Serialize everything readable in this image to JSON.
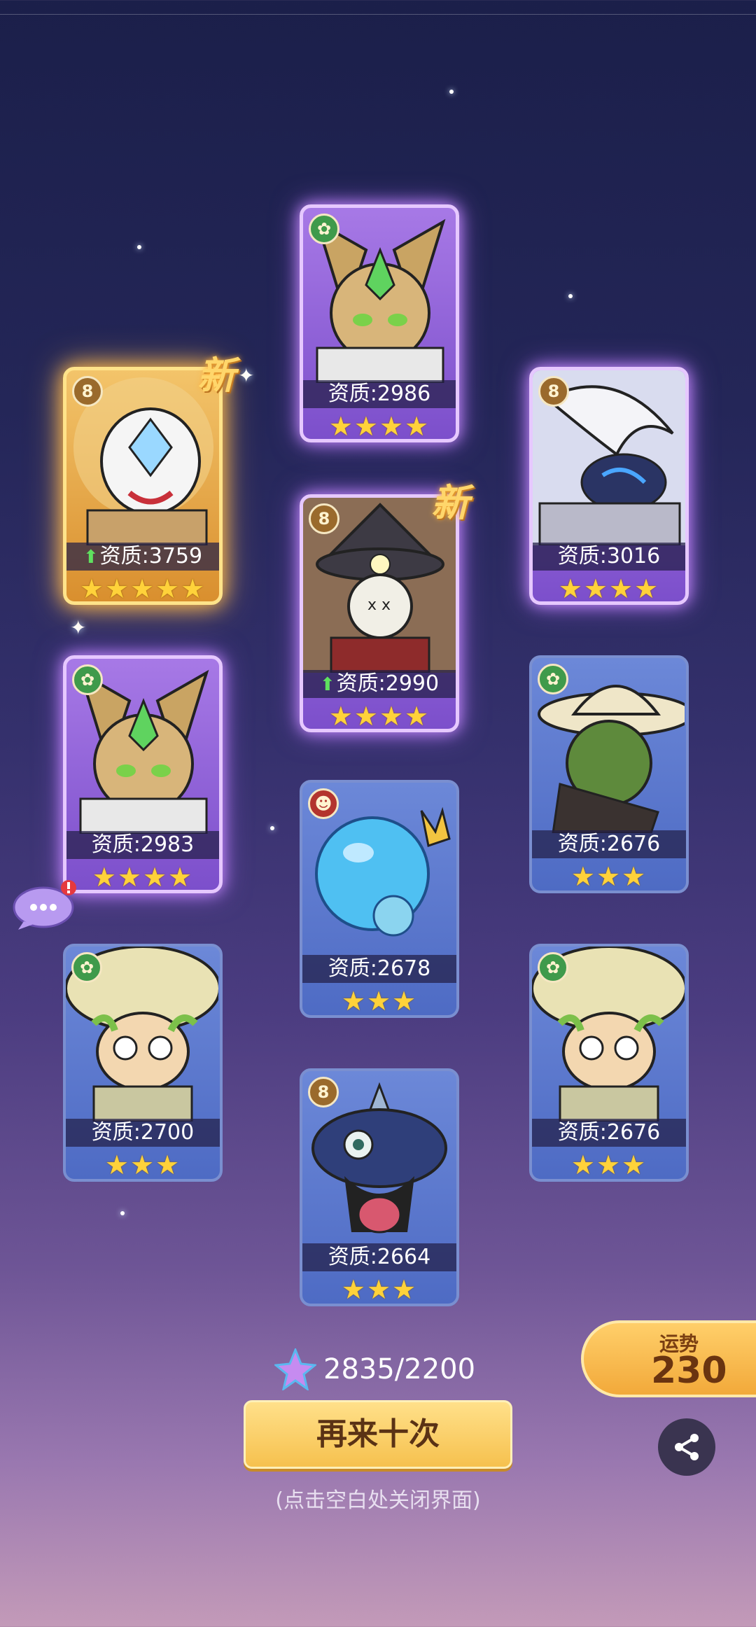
{
  "cards": [
    {
      "aptitude": "资质:2986",
      "stars": "★★★★",
      "rarity": "purple",
      "emblem": "leaf",
      "emblem_icon": "✿",
      "new": false,
      "up": false,
      "character": "green-armored rabbit warrior"
    },
    {
      "aptitude": "资质:3759",
      "stars": "★★★★★",
      "rarity": "gold",
      "emblem": "gear",
      "emblem_icon": "8",
      "new": true,
      "up": true,
      "character": "white tiger mecha"
    },
    {
      "aptitude": "资质:3016",
      "stars": "★★★★",
      "rarity": "purple",
      "emblem": "gear",
      "emblem_icon": "8",
      "new": false,
      "up": false,
      "character": "white dragon mech"
    },
    {
      "aptitude": "资质:2990",
      "stars": "★★★★",
      "rarity": "purple",
      "emblem": "gear",
      "emblem_icon": "8",
      "new": true,
      "up": true,
      "character": "scarecrow witch"
    },
    {
      "aptitude": "资质:2983",
      "stars": "★★★★",
      "rarity": "purple",
      "emblem": "leaf",
      "emblem_icon": "✿",
      "new": false,
      "up": false,
      "character": "green-armored rabbit warrior"
    },
    {
      "aptitude": "资质:2676",
      "stars": "★★★",
      "rarity": "blue",
      "emblem": "leaf",
      "emblem_icon": "✿",
      "new": false,
      "up": false,
      "character": "cactus cowboy"
    },
    {
      "aptitude": "资质:2678",
      "stars": "★★★",
      "rarity": "blue",
      "emblem": "fire",
      "emblem_icon": "☻",
      "new": false,
      "up": false,
      "character": "blue slime king"
    },
    {
      "aptitude": "资质:2700",
      "stars": "★★★",
      "rarity": "blue",
      "emblem": "leaf",
      "emblem_icon": "✿",
      "new": false,
      "up": false,
      "character": "mushroom kid"
    },
    {
      "aptitude": "资质:2676",
      "stars": "★★★",
      "rarity": "blue",
      "emblem": "leaf",
      "emblem_icon": "✿",
      "new": false,
      "up": false,
      "character": "mushroom kid"
    },
    {
      "aptitude": "资质:2664",
      "stars": "★★★",
      "rarity": "blue",
      "emblem": "gear",
      "emblem_icon": "8",
      "new": false,
      "up": false,
      "character": "tongue helmet monster"
    }
  ],
  "new_label": "新",
  "currency": {
    "text": "2835/2200"
  },
  "fortune": {
    "label": "运势",
    "value": "230"
  },
  "again_button": "再来十次",
  "close_hint": "(点击空白处关闭界面)",
  "colors": {
    "gold_glow": "#ffb84a",
    "purple_glow": "#c88cff",
    "button": "#f6c14e"
  }
}
